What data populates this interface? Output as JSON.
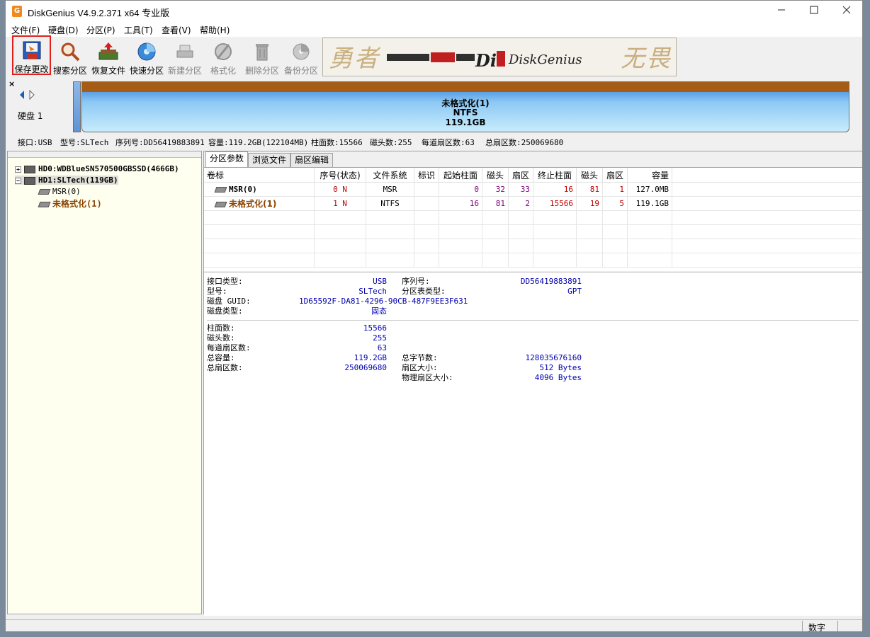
{
  "window": {
    "title": "DiskGenius V4.9.2.371 x64 专业版",
    "app_icon": "G",
    "minimize_icon": "minimize-icon",
    "maximize_icon": "maximize-icon",
    "close_icon": "close-icon"
  },
  "menu": [
    "文件(F)",
    "硬盘(D)",
    "分区(P)",
    "工具(T)",
    "查看(V)",
    "帮助(H)"
  ],
  "toolbar": [
    {
      "label": "保存更改",
      "icon": "save-icon",
      "enabled": true,
      "highlight": true
    },
    {
      "label": "搜索分区",
      "icon": "magnifier-icon",
      "enabled": true
    },
    {
      "label": "恢复文件",
      "icon": "restore-icon",
      "enabled": true
    },
    {
      "label": "快速分区",
      "icon": "quick-partition-icon",
      "enabled": true
    },
    {
      "label": "新建分区",
      "icon": "new-partition-icon",
      "enabled": false
    },
    {
      "label": "格式化",
      "icon": "format-icon",
      "enabled": false
    },
    {
      "label": "删除分区",
      "icon": "trash-icon",
      "enabled": false
    },
    {
      "label": "备份分区",
      "icon": "backup-icon",
      "enabled": false
    }
  ],
  "banner": {
    "title": "DiskGenius"
  },
  "diskmap": {
    "close": "×",
    "disk_label": "硬盘 1",
    "partition": {
      "name": "未格式化(1)",
      "fs": "NTFS",
      "size": "119.1GB"
    }
  },
  "infobar": {
    "interface": "接口:USB",
    "model": "型号:SLTech",
    "serial": "序列号:DD56419883891",
    "capacity": "容量:119.2GB(122104MB)",
    "cylinders": "柱面数:15566",
    "heads": "磁头数:255",
    "sectors_per_track": "每道扇区数:63",
    "total_sectors": "总扇区数:250069680"
  },
  "tree": {
    "hd0": "HD0:WDBlueSN570500GBSSD(466GB)",
    "hd1": "HD1:SLTech(119GB)",
    "msr": "MSR(0)",
    "unformatted": "未格式化(1)"
  },
  "tabs": [
    "分区参数",
    "浏览文件",
    "扇区编辑"
  ],
  "table": {
    "headers": [
      "卷标",
      "序号(状态)",
      "文件系统",
      "标识",
      "起始柱面",
      "磁头",
      "扇区",
      "终止柱面",
      "磁头",
      "扇区",
      "容量"
    ],
    "rows": [
      [
        "MSR(0)",
        "0 N",
        "MSR",
        "",
        "0",
        "32",
        "33",
        "16",
        "81",
        "1",
        "127.0MB"
      ],
      [
        "未格式化(1)",
        "1 N",
        "NTFS",
        "",
        "16",
        "81",
        "2",
        "15566",
        "19",
        "5",
        "119.1GB"
      ]
    ]
  },
  "details": {
    "interface_type_label": "接口类型:",
    "interface_type": "USB",
    "serial_label": "序列号:",
    "serial": "DD56419883891",
    "model_label": "型号:",
    "model": "SLTech",
    "pt_type_label": "分区表类型:",
    "pt_type": "GPT",
    "guid_label": "磁盘 GUID:",
    "guid": "1D65592F-DA81-4296-90CB-487F9EE3F631",
    "disk_type_label": "磁盘类型:",
    "disk_type": "固态",
    "cyl_label": "柱面数:",
    "cyl": "15566",
    "heads_label": "磁头数:",
    "heads": "255",
    "spt_label": "每道扇区数:",
    "spt": "63",
    "capacity_label": "总容量:",
    "capacity": "119.2GB",
    "total_bytes_label": "总字节数:",
    "total_bytes": "128035676160",
    "total_sectors_label": "总扇区数:",
    "total_sectors": "250069680",
    "sector_size_label": "扇区大小:",
    "sector_size": "512 Bytes",
    "phys_sector_label": "物理扇区大小:",
    "phys_sector": "4096 Bytes"
  },
  "status": {
    "mode": "数字"
  }
}
